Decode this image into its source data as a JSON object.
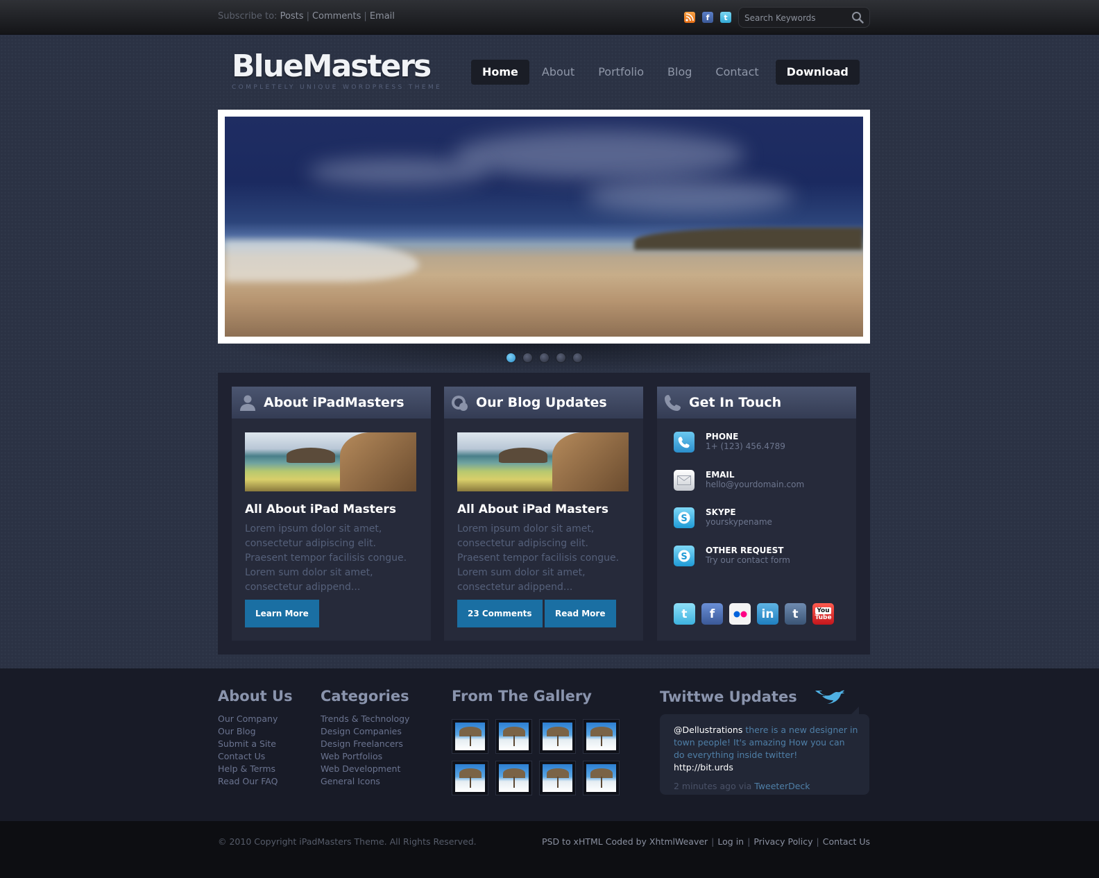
{
  "topbar": {
    "subscribe_label": "Subscribe to:",
    "links": [
      "Posts",
      "Comments",
      "Email"
    ],
    "search_placeholder": "Search Keywords",
    "icons": [
      "rss-icon",
      "facebook-icon",
      "twitter-icon"
    ]
  },
  "brand": {
    "name": "BlueMasters",
    "tagline": "COMPLETELY UNIQUE WORDPRESS THEME"
  },
  "nav": {
    "items": [
      "Home",
      "About",
      "Portfolio",
      "Blog",
      "Contact"
    ],
    "download": "Download",
    "active": "Home"
  },
  "slider": {
    "slide_count": 5,
    "active_slide": 1
  },
  "about": {
    "heading": "About iPadMasters",
    "title": "All About iPad Masters",
    "body": "Lorem ipsum dolor sit amet, consectetur adipiscing elit. Praesent tempor facilisis congue. Lorem sum dolor sit amet, consectetur adippend...",
    "button": "Learn More"
  },
  "blog": {
    "heading": "Our Blog Updates",
    "title": "All About iPad Masters",
    "body": "Lorem ipsum dolor sit amet, consectetur adipiscing elit. Praesent tempor facilisis congue. Lorem sum dolor sit amet, consectetur adippend...",
    "comments_button": "23 Comments",
    "read_button": "Read More"
  },
  "contact": {
    "heading": "Get In Touch",
    "rows": [
      {
        "key": "PHONE",
        "value": "1+ (123) 456.4789"
      },
      {
        "key": "EMAIL",
        "value": "hello@yourdomain.com"
      },
      {
        "key": "SKYPE",
        "value": "yourskypename"
      },
      {
        "key": "OTHER REQUEST",
        "value": "Try our contact form"
      }
    ],
    "social_icons": [
      "twitter-icon",
      "facebook-icon",
      "flickr-icon",
      "linkedin-icon",
      "tumblr-icon",
      "youtube-icon"
    ],
    "youtube_top": "You",
    "youtube_bottom": "Tube"
  },
  "footer": {
    "about_heading": "About Us",
    "about_links": [
      "Our Company",
      "Our Blog",
      "Submit a Site",
      "Contact Us",
      "Help & Terms",
      "Read Our FAQ"
    ],
    "categories_heading": "Categories",
    "categories": [
      "Trends & Technology",
      "Design Companies",
      "Design Freelancers",
      "Web Portfolios",
      "Web Development",
      "General Icons"
    ],
    "gallery_heading": "From The Gallery",
    "gallery_count": 8,
    "twitter_heading": "Twittwe Updates",
    "tweet_user": "@Dellustrations",
    "tweet_text": " there is a new designer in town people! It's amazing How you can do everything inside twitter! ",
    "tweet_link": "http://bit.urds",
    "tweet_meta": "2 minutes ago via ",
    "tweet_source": "TweeterDeck"
  },
  "bottom": {
    "copyright": "© 2010 Copyright iPadMasters Theme. All Rights Reserved.",
    "links": [
      "PSD to xHTML Coded by XhtmlWeaver",
      "Log in",
      "Privacy Policy",
      "Contact Us"
    ]
  },
  "colors": {
    "accent": "#1a6fa3",
    "background": "#2b3244",
    "panel": "#262a3a",
    "footer": "#181b27"
  }
}
